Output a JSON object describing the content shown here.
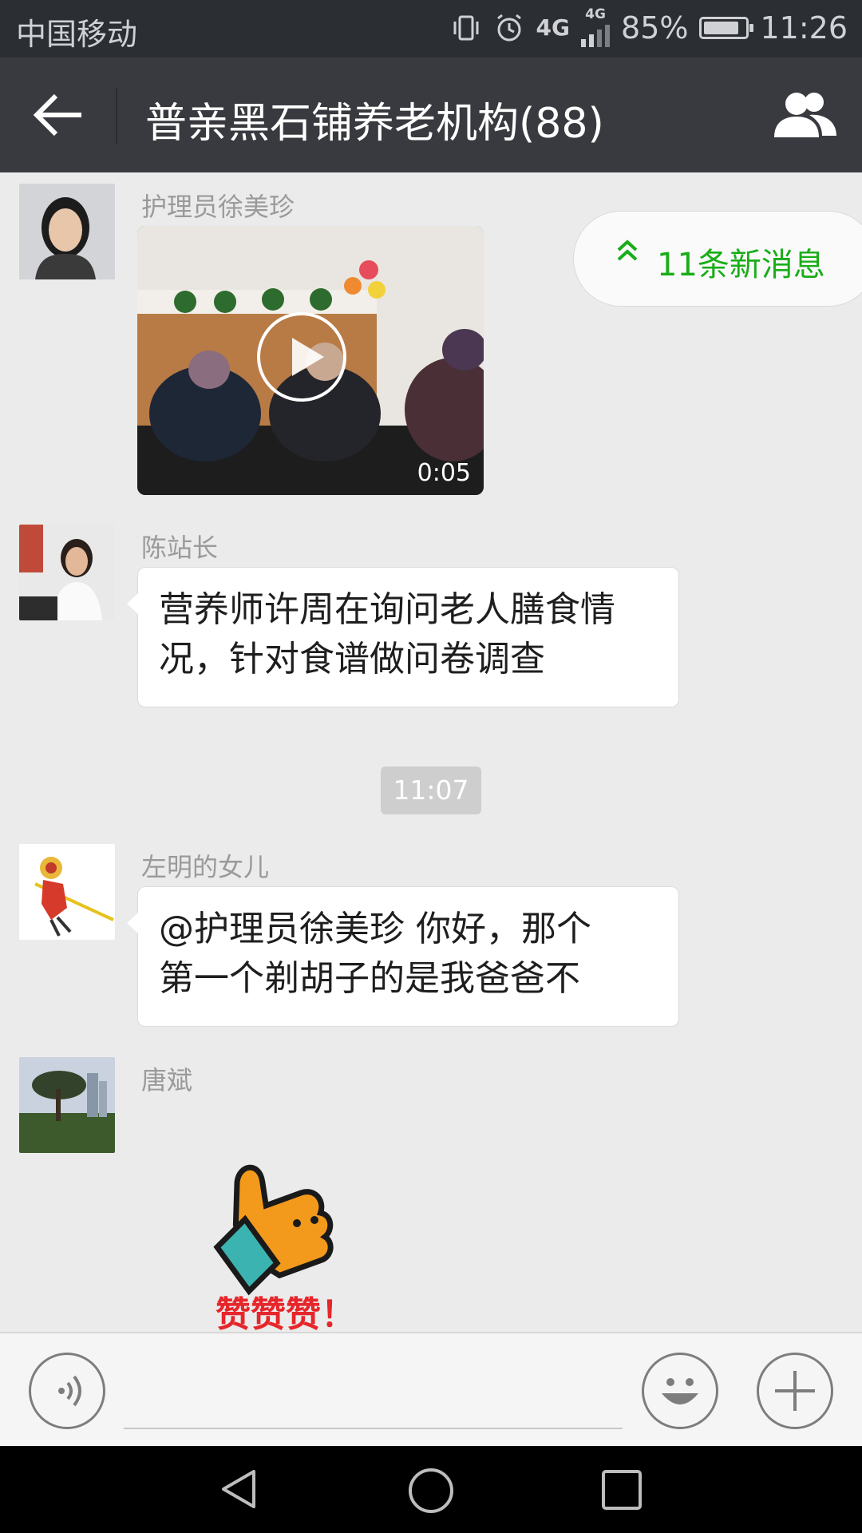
{
  "status_bar": {
    "carrier": "中国移动",
    "network": "4G",
    "network2": "4G",
    "battery": "85%",
    "battery_level": 0.85,
    "time": "11:26"
  },
  "header": {
    "title": "普亲黑石铺养老机构(88)"
  },
  "new_messages": {
    "label": "11条新消息"
  },
  "messages": [
    {
      "sender": "护理员徐美珍",
      "type": "video",
      "duration": "0:05"
    },
    {
      "sender": "陈站长",
      "type": "text",
      "text_line1": "营养师许周在询问老人膳食情",
      "text_line2": "况，针对食谱做问卷调查"
    },
    {
      "sender": "左明的女儿",
      "type": "text",
      "text_line1": "@护理员徐美珍 你好，那个",
      "text_line2": "第一个剃胡子的是我爸爸不"
    },
    {
      "sender": "唐斌",
      "type": "sticker",
      "sticker_text": "赞赞赞！"
    }
  ],
  "timestamp": "11:07",
  "icons": {
    "back": "back-arrow-icon",
    "members": "group-members-icon",
    "voice": "voice-input-icon",
    "emoji": "emoji-icon",
    "plus": "plus-icon"
  },
  "colors": {
    "header_bg": "#393a3f",
    "status_bg": "#2b2e33",
    "chat_bg": "#ebebeb",
    "accent_green": "#1aad19"
  }
}
